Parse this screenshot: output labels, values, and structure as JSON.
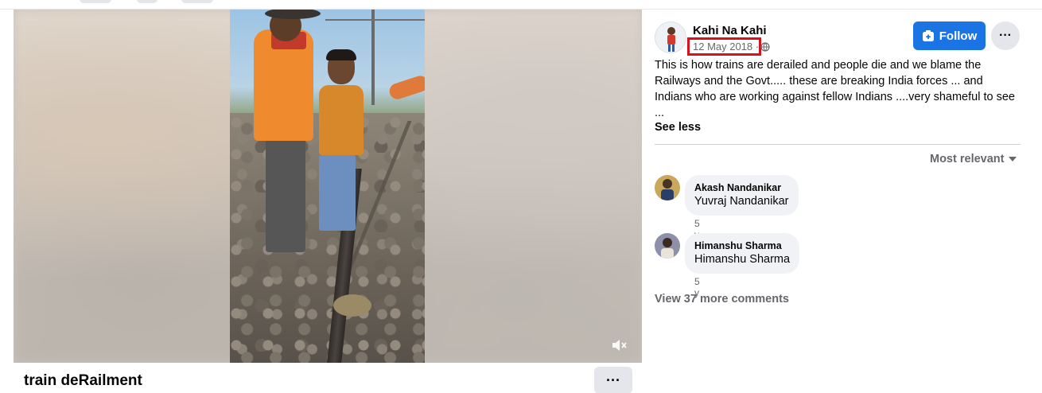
{
  "video": {
    "caption": "train deRailment",
    "more_label": "···",
    "mute_icon": "speaker-muted-icon"
  },
  "post": {
    "author": "Kahi Na Kahi",
    "date": "12 May 2018",
    "date_separator": "·",
    "privacy_icon": "globe-icon",
    "follow_label": "Follow",
    "more_label": "···",
    "text": "This is how trains are derailed and people die and we blame the Railways and the Govt..... these are breaking India forces ... and Indians who are working against fellow Indians ....very shameful to see ...",
    "see_less": "See less"
  },
  "comments": {
    "sort_label": "Most relevant",
    "items": [
      {
        "name": "Akash Nandanikar",
        "text": "Yuvraj Nandanikar",
        "time": "5 y"
      },
      {
        "name": "Himanshu Sharma",
        "text": "Himanshu Sharma",
        "time": "5 y"
      }
    ],
    "view_more": "View 37 more comments"
  },
  "colors": {
    "accent": "#1b74e4",
    "highlight_box": "#d8121b",
    "secondary_text": "#65676b"
  }
}
